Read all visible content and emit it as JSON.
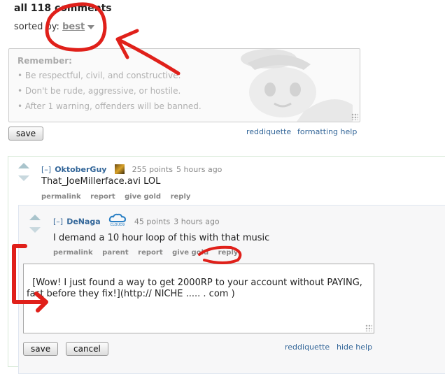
{
  "header": {
    "comments_title": "all 118 comments",
    "sort_label": "sorted by:",
    "sort_value": "best"
  },
  "reminder": {
    "title": "Remember:",
    "rules": [
      "• Be respectful, civil, and constructive.",
      "• Don't be rude, aggressive, or hostile.",
      "• After 1 warning, offenders will be banned."
    ],
    "save_label": "save",
    "reddiquette_label": "reddiquette",
    "formatting_help_label": "formatting help"
  },
  "comment": {
    "collapse": "[–]",
    "author": "OktoberGuy",
    "points": "255 points",
    "time": "5 hours ago",
    "body": "That_JoeMillerface.avi LOL",
    "actions": [
      "permalink",
      "report",
      "give gold",
      "reply"
    ]
  },
  "child_comment": {
    "collapse": "[–]",
    "author": "DeNaga",
    "flair_text": "CLOUD9",
    "points": "45 points",
    "time": "3 hours ago",
    "body": "I demand a 10 hour loop of this with that music",
    "actions": [
      "permalink",
      "parent",
      "report",
      "give gold",
      "reply"
    ]
  },
  "reply_form": {
    "text": "[Wow! I just found a way to get 2000RP to your account without PAYING, fast before they fix!](http:// NICHE ..... . com )",
    "save_label": "save",
    "cancel_label": "cancel",
    "reddiquette_label": "reddiquette",
    "hide_help_label": "hide help"
  },
  "colors": {
    "link": "#336699",
    "annotation": "#e0201a"
  }
}
